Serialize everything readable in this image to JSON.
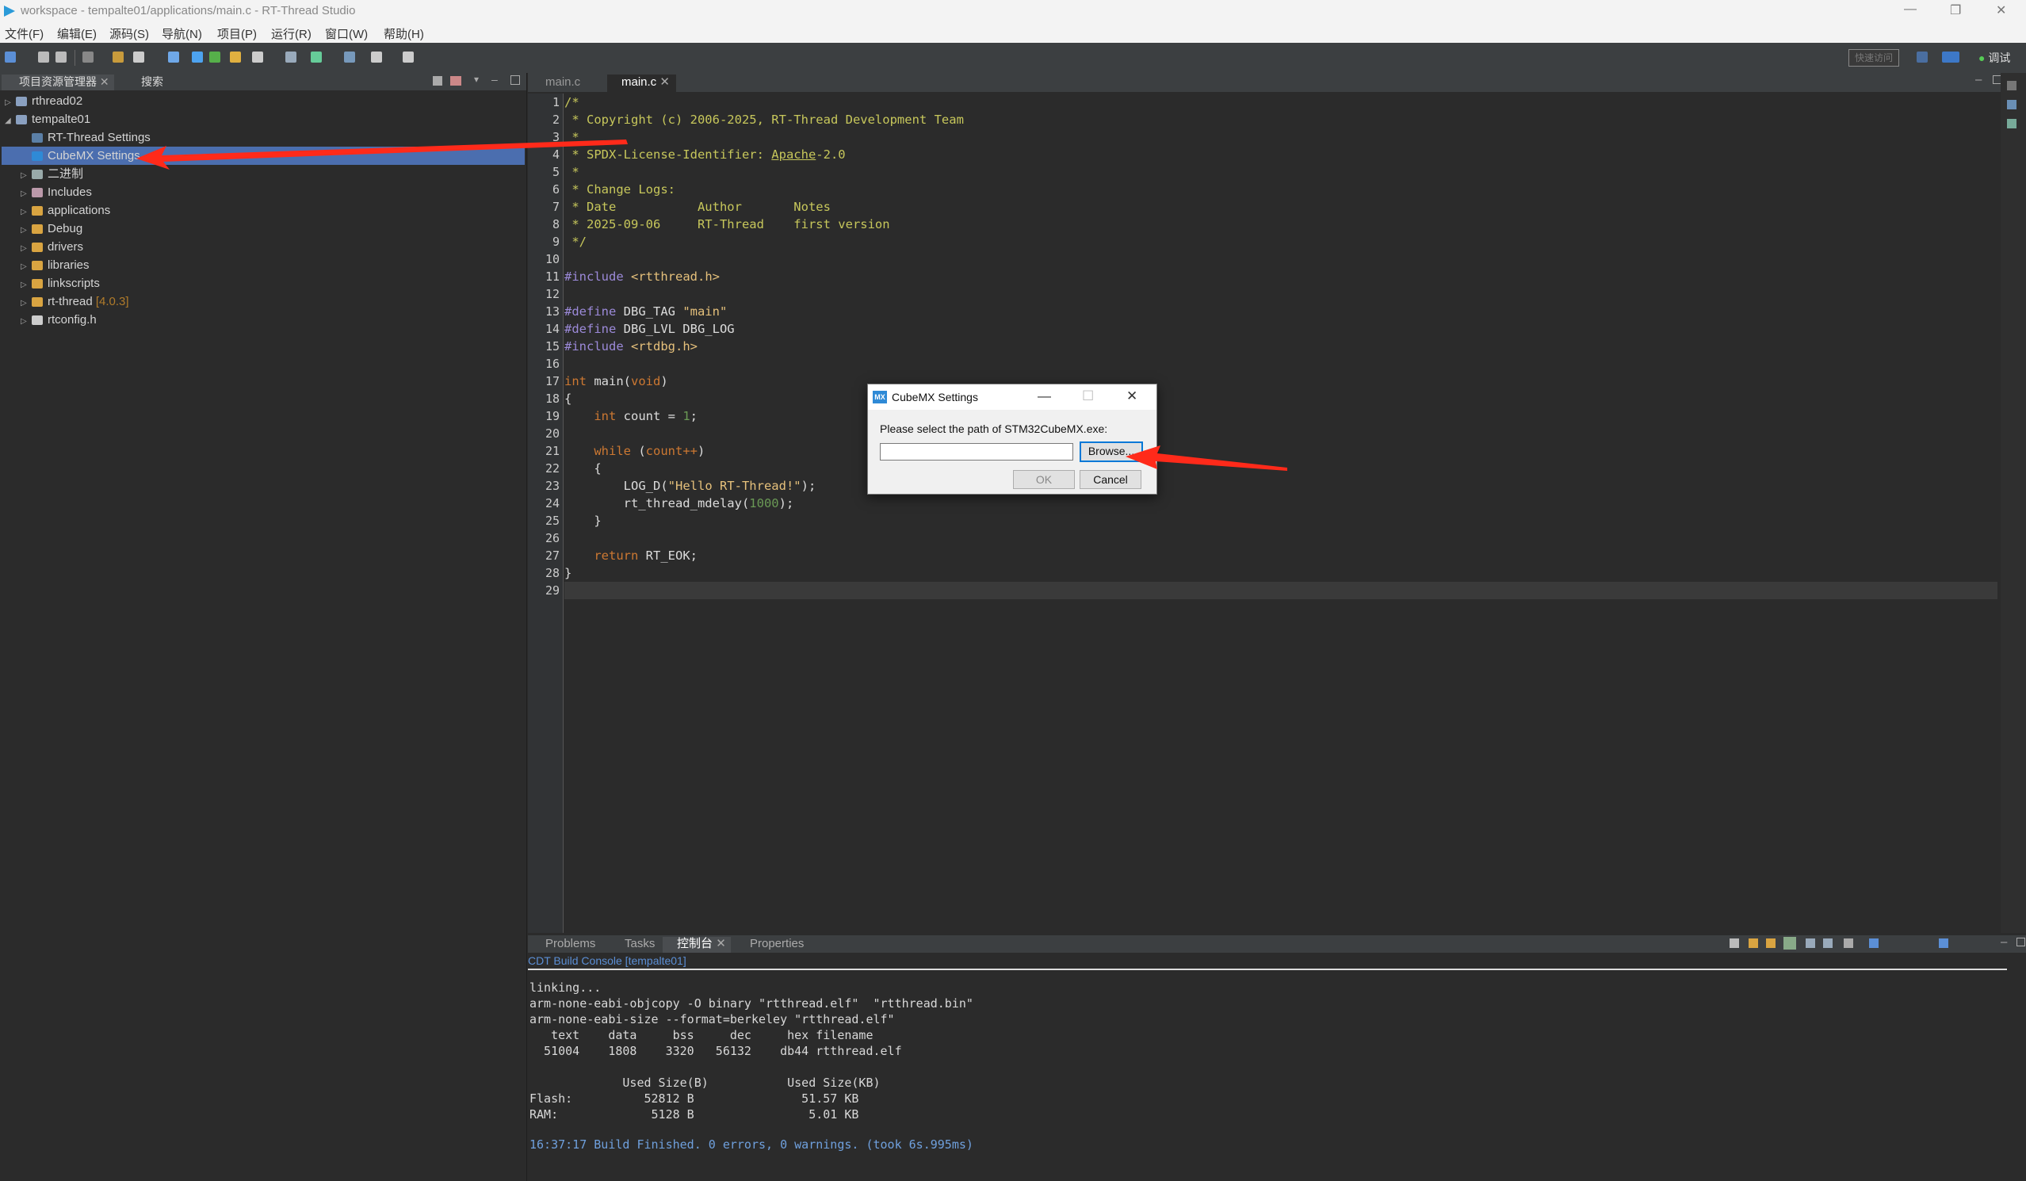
{
  "window": {
    "title": "workspace - tempalte01/applications/main.c - RT-Thread Studio",
    "controls": [
      "—",
      "❐",
      "✕"
    ]
  },
  "menubar": [
    "文件(F)",
    "编辑(E)",
    "源码(S)",
    "导航(N)",
    "项目(P)",
    "运行(R)",
    "窗口(W)",
    "帮助(H)"
  ],
  "toolbar": {
    "quick_access": "快速访问",
    "debug_label": "调试"
  },
  "left_panel": {
    "tabs": [
      "项目资源管理器",
      "搜索"
    ],
    "tree": [
      {
        "label": "rthread02",
        "level": 0,
        "arrow": "▷",
        "icon": "project-icon"
      },
      {
        "label": "tempalte01",
        "level": 0,
        "arrow": "◢",
        "icon": "project-icon"
      },
      {
        "label": "RT-Thread Settings",
        "level": 1,
        "arrow": "",
        "icon": "settings-icon"
      },
      {
        "label": "CubeMX Settings",
        "level": 1,
        "arrow": "",
        "icon": "cubemx-icon",
        "selected": true
      },
      {
        "label": "二进制",
        "level": 1,
        "arrow": "▷",
        "icon": "binary-icon"
      },
      {
        "label": "Includes",
        "level": 1,
        "arrow": "▷",
        "icon": "includes-icon"
      },
      {
        "label": "applications",
        "level": 1,
        "arrow": "▷",
        "icon": "folder-icon"
      },
      {
        "label": "Debug",
        "level": 1,
        "arrow": "▷",
        "icon": "folder-icon"
      },
      {
        "label": "drivers",
        "level": 1,
        "arrow": "▷",
        "icon": "folder-icon"
      },
      {
        "label": "libraries",
        "level": 1,
        "arrow": "▷",
        "icon": "folder-icon"
      },
      {
        "label": "linkscripts",
        "level": 1,
        "arrow": "▷",
        "icon": "folder-icon"
      },
      {
        "label": "rt-thread",
        "level": 1,
        "arrow": "▷",
        "icon": "folder-icon",
        "version": "[4.0.3]"
      },
      {
        "label": "rtconfig.h",
        "level": 1,
        "arrow": "▷",
        "icon": "file-icon"
      }
    ]
  },
  "editor": {
    "tabs": [
      {
        "label": "main.c",
        "active": false
      },
      {
        "label": "main.c",
        "active": true
      }
    ],
    "line_numbers": [
      "1",
      "2",
      "3",
      "4",
      "5",
      "6",
      "7",
      "8",
      "9",
      "10",
      "11",
      "12",
      "13",
      "14",
      "15",
      "16",
      "17",
      "18",
      "19",
      "20",
      "21",
      "22",
      "23",
      "24",
      "25",
      "26",
      "27",
      "28",
      "29"
    ],
    "lines": [
      [
        [
          "cm",
          "/*"
        ]
      ],
      [
        [
          "cm",
          " * Copyright (c) 2006-2025, RT-Thread Development Team"
        ]
      ],
      [
        [
          "cm",
          " *"
        ]
      ],
      [
        [
          "cm",
          " * SPDX-License-Identifier: "
        ],
        [
          "cm ul",
          "Apache"
        ],
        [
          "cm",
          "-2.0"
        ]
      ],
      [
        [
          "cm",
          " *"
        ]
      ],
      [
        [
          "cm",
          " * Change Logs:"
        ]
      ],
      [
        [
          "cm",
          " * Date           Author       Notes"
        ]
      ],
      [
        [
          "cm",
          " * 2025-09-06     RT-Thread    first version"
        ]
      ],
      [
        [
          "cm",
          " */"
        ]
      ],
      [],
      [
        [
          "pp",
          "#include "
        ],
        [
          "str",
          "<rtthread.h>"
        ]
      ],
      [],
      [
        [
          "pp",
          "#define "
        ],
        [
          "",
          "DBG_TAG "
        ],
        [
          "str",
          "\"main\""
        ]
      ],
      [
        [
          "pp",
          "#define "
        ],
        [
          "",
          "DBG_LVL DBG_LOG"
        ]
      ],
      [
        [
          "pp",
          "#include "
        ],
        [
          "str",
          "<rtdbg.h>"
        ]
      ],
      [],
      [
        [
          "kw",
          "int "
        ],
        [
          "",
          "main("
        ],
        [
          "kw",
          "void"
        ],
        [
          "",
          ")"
        ]
      ],
      [
        [
          "",
          "{"
        ]
      ],
      [
        [
          "",
          "    "
        ],
        [
          "kw",
          "int "
        ],
        [
          "",
          "count = "
        ],
        [
          "num",
          "1"
        ],
        [
          "",
          ";"
        ]
      ],
      [],
      [
        [
          "",
          "    "
        ],
        [
          "kw",
          "while "
        ],
        [
          "",
          "("
        ],
        [
          "kw",
          "count++"
        ],
        [
          "",
          ")"
        ]
      ],
      [
        [
          "",
          "    {"
        ]
      ],
      [
        [
          "",
          "        LOG_D("
        ],
        [
          "str",
          "\"Hello RT-Thread!\""
        ],
        [
          "",
          ");"
        ]
      ],
      [
        [
          "",
          "        rt_thread_mdelay("
        ],
        [
          "num",
          "1000"
        ],
        [
          "",
          ");"
        ]
      ],
      [
        [
          "",
          "    }"
        ]
      ],
      [],
      [
        [
          "",
          "    "
        ],
        [
          "kw",
          "return "
        ],
        [
          "",
          "RT_EOK;"
        ]
      ],
      [
        [
          "",
          "}"
        ]
      ],
      []
    ]
  },
  "console": {
    "tabs": [
      "Problems",
      "Tasks",
      "控制台",
      "Properties"
    ],
    "title": "CDT Build Console [tempalte01]",
    "lines": [
      "linking...",
      "arm-none-eabi-objcopy -O binary \"rtthread.elf\"  \"rtthread.bin\"",
      "arm-none-eabi-size --format=berkeley \"rtthread.elf\"",
      "   text    data     bss     dec     hex filename",
      "  51004    1808    3320   56132    db44 rtthread.elf",
      "",
      "             Used Size(B)           Used Size(KB)",
      "Flash:          52812 B               51.57 KB",
      "RAM:             5128 B                5.01 KB",
      ""
    ],
    "finish_line": "16:37:17 Build Finished. 0 errors, 0 warnings. (took 6s.995ms)"
  },
  "dialog": {
    "title": "CubeMX Settings",
    "icon_text": "MX",
    "prompt": "Please select the path of STM32CubeMX.exe:",
    "path_value": "",
    "browse_label": "Browse...",
    "ok_label": "OK",
    "cancel_label": "Cancel",
    "controls": [
      "—",
      "☐",
      "✕"
    ]
  },
  "colors": {
    "annotation_arrow": "#ff2a1a",
    "selection": "#4b6eaf"
  }
}
